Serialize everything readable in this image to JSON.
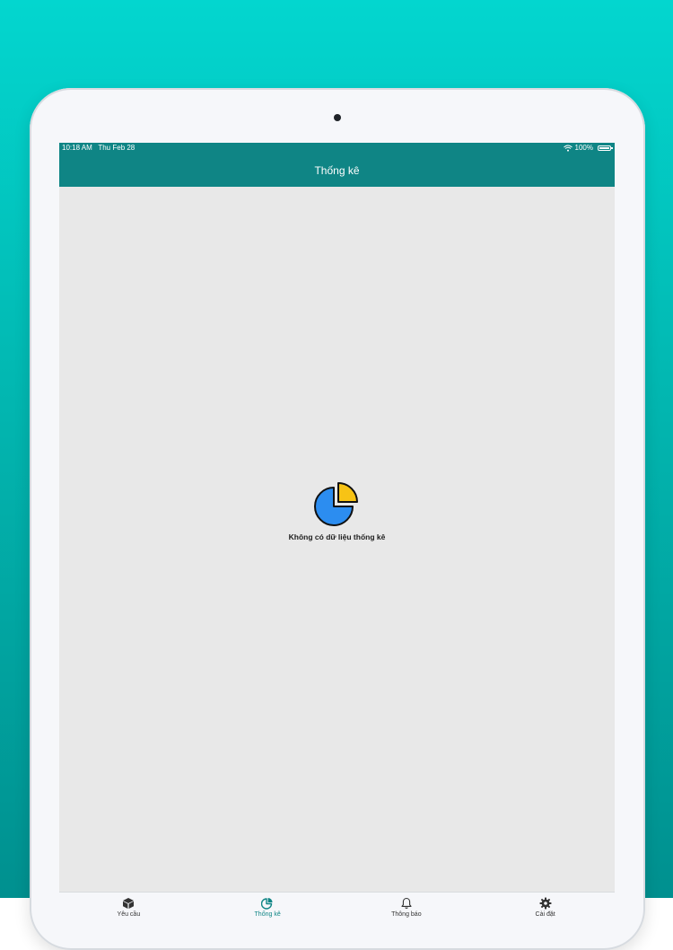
{
  "status_bar": {
    "time": "10:18 AM",
    "date": "Thu Feb 28",
    "battery": "100%"
  },
  "header": {
    "title": "Thống kê"
  },
  "empty_state": {
    "icon": "pie-chart-icon",
    "message": "Không có dữ liệu thống kê"
  },
  "tab_bar": {
    "active_index": 1,
    "items": [
      {
        "label": "Yêu cầu",
        "icon": "box-icon"
      },
      {
        "label": "Thống kê",
        "icon": "pie-chart-icon"
      },
      {
        "label": "Thông báo",
        "icon": "bell-icon"
      },
      {
        "label": "Cài đặt",
        "icon": "gear-icon"
      }
    ]
  },
  "colors": {
    "primary": "#0f8585",
    "pie_blue": "#2c8df0",
    "pie_yellow": "#f7c315",
    "screen_background": "#e8e8e8"
  }
}
